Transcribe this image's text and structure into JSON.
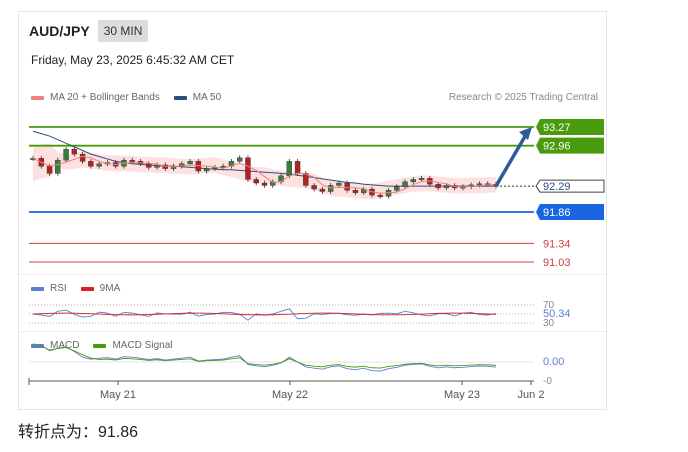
{
  "header": {
    "symbol": "AUD/JPY",
    "timeframe": "30 MIN",
    "datetime": "Friday, May 23, 2025 6:45:32 AM CET"
  },
  "legend": {
    "ma20_label": "MA 20 + Bollinger Bands",
    "ma50_label": "MA 50",
    "credit": "Research © 2025 Trading Central"
  },
  "rsi_legend": {
    "rsi_label": "RSI",
    "ma_label": "9MA"
  },
  "macd_legend": {
    "macd_label": "MACD",
    "signal_label": "MACD Signal"
  },
  "footer": {
    "pivot_text": "转折点为：91.86"
  },
  "colors": {
    "resistance": "#4a9a0e",
    "pivot": "#1a66e0",
    "support": "#d04040",
    "ma20": "#f08080",
    "ma50": "#2b4f80",
    "band": "#fde1e1",
    "rsi": "#5b7fd0",
    "rsi_ma": "#d82020",
    "macd": "#5b7fd0",
    "macd_signal": "#4a9a0e",
    "arrow": "#2d5b9a"
  },
  "chart_data": {
    "type": "line",
    "title": "AUD/JPY",
    "x_ticks": [
      "May 21",
      "May 22",
      "May 23",
      "Jun 2"
    ],
    "price_levels": [
      {
        "label": "93.27",
        "value": 93.27,
        "kind": "resistance"
      },
      {
        "label": "92.96",
        "value": 92.96,
        "kind": "resistance"
      },
      {
        "label": "92.29",
        "value": 92.29,
        "kind": "current"
      },
      {
        "label": "91.86",
        "value": 91.86,
        "kind": "pivot"
      },
      {
        "label": "91.34",
        "value": 91.34,
        "kind": "support"
      },
      {
        "label": "91.03",
        "value": 91.03,
        "kind": "support"
      }
    ],
    "price_series": [
      92.75,
      92.62,
      92.5,
      92.72,
      92.9,
      92.82,
      92.7,
      92.62,
      92.66,
      92.68,
      92.62,
      92.72,
      92.7,
      92.66,
      92.6,
      92.64,
      92.58,
      92.62,
      92.66,
      92.7,
      92.54,
      92.58,
      92.6,
      92.62,
      92.7,
      92.76,
      92.4,
      92.34,
      92.3,
      92.36,
      92.46,
      92.7,
      92.5,
      92.3,
      92.24,
      92.2,
      92.3,
      92.34,
      92.22,
      92.18,
      92.24,
      92.14,
      92.12,
      92.22,
      92.28,
      92.36,
      92.4,
      92.42,
      92.32,
      92.26,
      92.3,
      92.26,
      92.28,
      92.31,
      92.33,
      92.32,
      92.29
    ],
    "ma50_series": [
      93.2,
      93.16,
      93.12,
      93.06,
      93.0,
      92.94,
      92.88,
      92.82,
      92.78,
      92.74,
      92.7,
      92.68,
      92.66,
      92.65,
      92.64,
      92.63,
      92.62,
      92.62,
      92.61,
      92.6,
      92.59,
      92.58,
      92.57,
      92.56,
      92.56,
      92.55,
      92.54,
      92.53,
      92.52,
      92.51,
      92.5,
      92.49,
      92.47,
      92.45,
      92.43,
      92.41,
      92.39,
      92.37,
      92.35,
      92.34,
      92.32,
      92.31,
      92.3,
      92.29,
      92.29,
      92.29,
      92.29,
      92.29,
      92.29,
      92.29,
      92.29,
      92.29,
      92.29,
      92.29,
      92.29,
      92.29,
      92.29
    ],
    "projection_target": 93.27,
    "rsi": {
      "levels": [
        70,
        50.34,
        30
      ],
      "current": 50.34
    },
    "macd": {
      "levels": [
        0.0,
        0
      ],
      "level_labels": [
        "0.00",
        "-0"
      ]
    }
  }
}
